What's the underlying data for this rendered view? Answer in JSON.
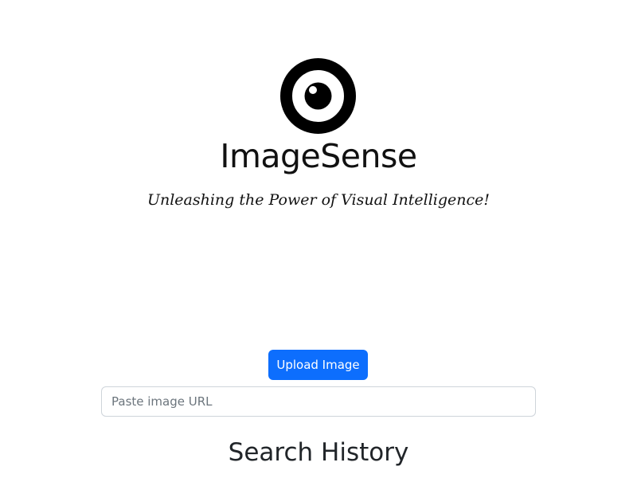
{
  "brand": {
    "name": "ImageSense",
    "tagline": "Unleashing the Power of Visual Intelligence!",
    "logo_icon": "eye-icon"
  },
  "upload": {
    "button_label": "Upload Image"
  },
  "url_input": {
    "placeholder": "Paste image URL",
    "value": ""
  },
  "history": {
    "title": "Search History"
  },
  "colors": {
    "primary": "#0d6efd",
    "text": "#212529",
    "logo": "#000000",
    "input_border": "#ced4da",
    "placeholder": "#6c757d"
  }
}
